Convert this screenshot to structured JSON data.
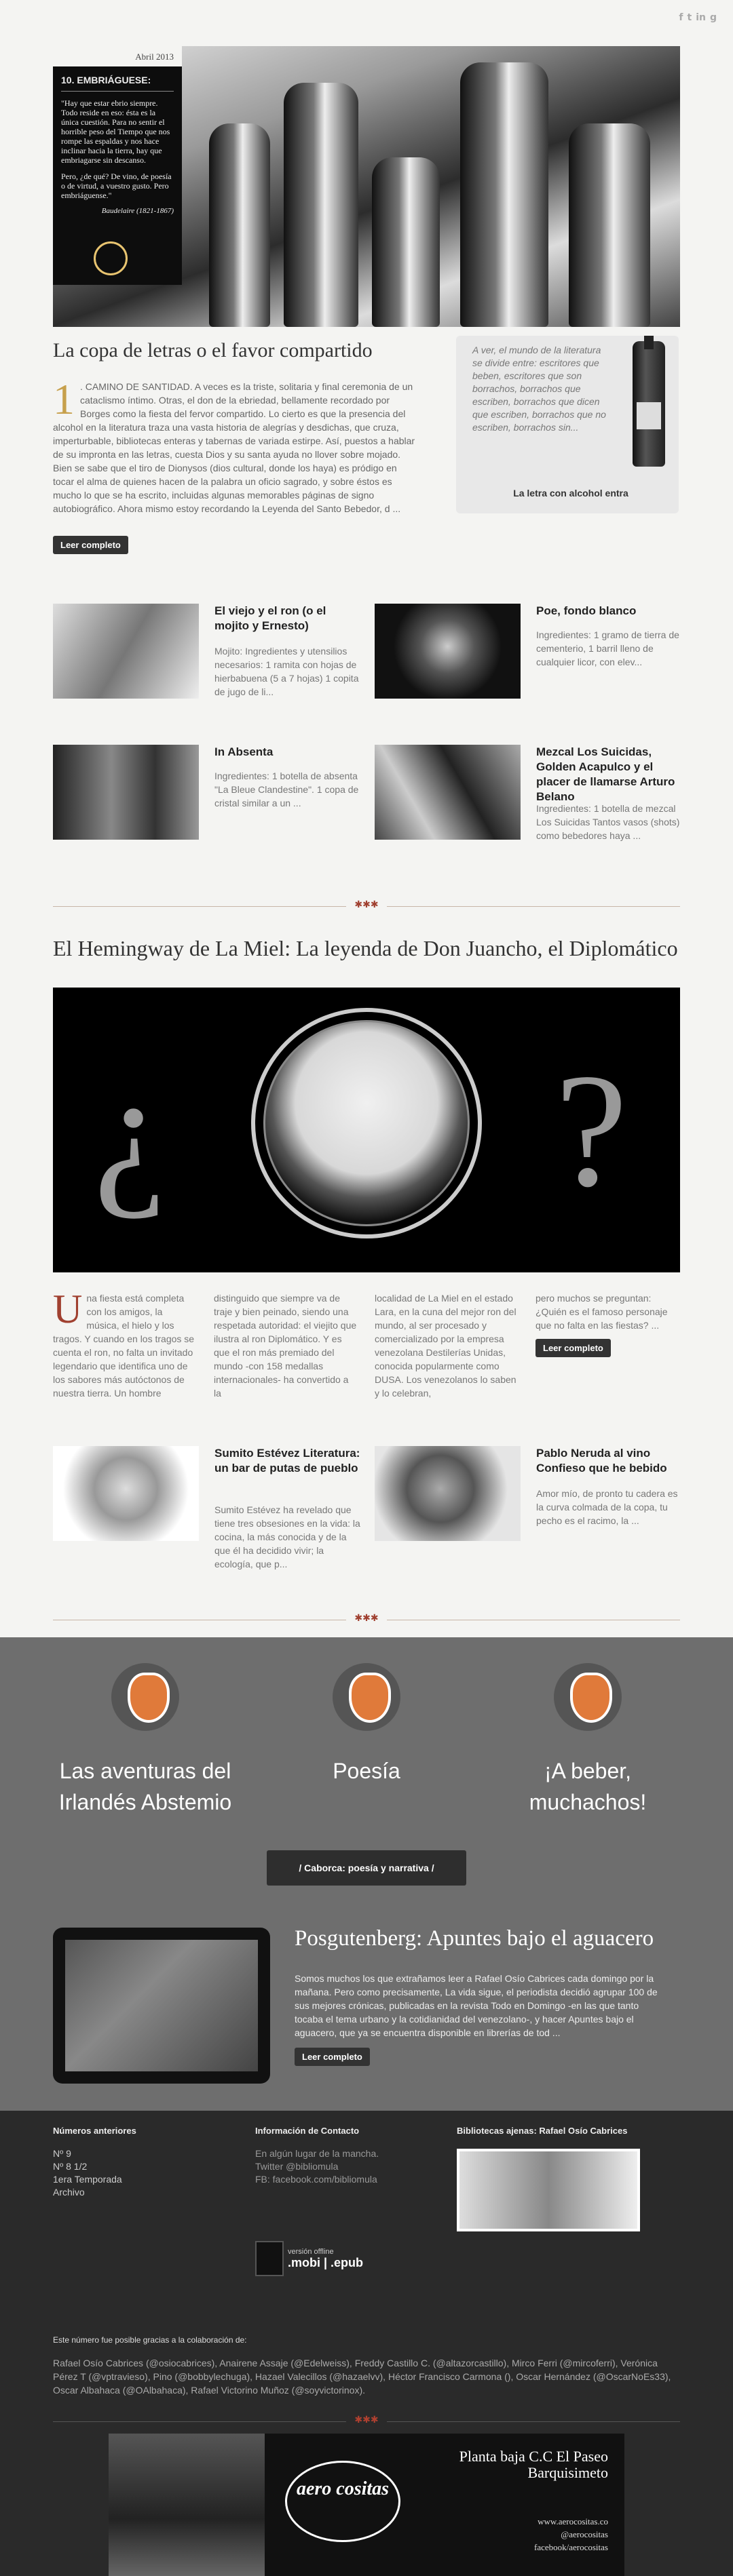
{
  "social": [
    "f",
    "t",
    "in",
    "g"
  ],
  "hero": {
    "date": "Abril 2013",
    "card_title": "10. EMBRIÁGUESE:",
    "card_p1": "\"Hay que estar ebrio siempre. Todo reside en eso: ésta es la única cuestión. Para no sentir el horrible peso del Tiempo que nos rompe las espaldas y nos hace inclinar hacia la tierra, hay que embriagarse sin descanso.",
    "card_p2": "Pero, ¿de qué? De vino, de poesía o de virtud, a vuestro gusto. Pero embriáguense.\"",
    "card_sig": "Baudelaire (1821-1867)"
  },
  "main": {
    "title": "La copa de letras o el favor compartido",
    "drop": "1",
    "lead": ". CAMINO DE SANTIDAD. A veces es la triste, solitaria y final ceremonia de un cataclismo íntimo. Otras, el don de la ebriedad, bellamente recordado por Borges como la fiesta del fervor compartido. Lo cierto es que la presencia del alcohol en la literatura traza una vasta historia de alegrías y desdichas, que cruza, imperturbable, bibliotecas enteras y tabernas de variada estirpe. Así, puestos a hablar de su impronta en las letras, cuesta Dios y su santa ayuda no llover sobre mojado. Bien se sabe que el tiro de Dionysos (dios cultural, donde los haya) es pródigo en tocar el alma de quienes hacen de la palabra un oficio sagrado, y sobre éstos es mucho lo que se ha escrito, incluidas algunas memorables páginas de signo autobiográfico. Ahora mismo estoy recordando la Leyenda del Santo Bebedor, d ...",
    "btn": "Leer completo"
  },
  "quote": {
    "text": "A ver, el mundo de la literatura se divide entre: escritores que beben, escritores que son borrachos, borrachos que escriben, borrachos que dicen que escriben, borrachos que no escriben, borrachos sin...",
    "label": "La letra con alcohol entra"
  },
  "cards1": [
    {
      "title": "El viejo y el ron (o el mojito y Ernesto)",
      "excerpt": "Mojito: Ingredientes y utensilios necesarios: 1 ramita con hojas de hierbabuena (5 a 7 hojas) 1 copita de jugo de li..."
    },
    {
      "title": "Poe, fondo blanco",
      "excerpt": "Ingredientes: 1 gramo de tierra de cementerio, 1 barril lleno de cualquier licor, con elev..."
    },
    {
      "title": "In Absenta",
      "excerpt": "Ingredientes: 1 botella de absenta \"La Bleue Clandestine\". 1 copa de cristal similar a un ..."
    },
    {
      "title": "Mezcal Los Suicidas, Golden Acapulco y el placer de llamarse Arturo Belano",
      "excerpt": "Ingredientes: 1 botella de mezcal Los Suicidas Tantos vasos (shots) como bebedores haya ..."
    }
  ],
  "sep": "✱✱✱",
  "feature": {
    "title": "El Hemingway de La Miel: La leyenda de Don Juancho, el Diplomático",
    "q_left": "¿",
    "q_right": "?",
    "drop": "U",
    "col1": "na fiesta está completa con los amigos, la música, el hielo y los tragos. Y cuando en los tragos se cuenta el ron, no falta un invitado legendario que identifica uno de los sabores más autóctonos de nuestra tierra. Un hombre",
    "col2": "distinguido que siempre va de traje y bien peinado, siendo una respetada autoridad: el viejito que ilustra al ron Diplomático. Y es que el ron más premiado del mundo -con 158 medallas internacionales- ha convertido a la",
    "col3": "localidad de La Miel en el estado Lara, en la cuna del mejor ron del mundo, al ser procesado y comercializado por la empresa venezolana Destilerías Unidas, conocida popularmente como DUSA. Los venezolanos lo saben y lo celebran,",
    "col4": "pero muchos se preguntan: ¿Quién es el famoso personaje que no falta en las fiestas? ...",
    "btn": "Leer completo"
  },
  "cards2": [
    {
      "title": "Sumito Estévez Literatura: un bar de putas de pueblo",
      "excerpt": "Sumito Estévez ha revelado que tiene tres obsesiones en la vida: la cocina, la más conocida y de la que él ha decidido vivir; la ecología, que p..."
    },
    {
      "title": "Pablo Neruda al vino Confieso que he bebido",
      "excerpt": "Amor mío, de pronto tu cadera es la curva colmada de la copa, tu pecho es el racimo, la ..."
    }
  ],
  "grey": {
    "t1": "Las aventuras del Irlandés Abstemio",
    "t2": "Poesía",
    "t3": "¡A beber, muchachos!",
    "btn": "/ Caborca: poesía y narrativa /",
    "pos_title": "Posgutenberg: Apuntes bajo el aguacero",
    "pos_text": "Somos muchos los que extrañamos leer a Rafael Osío Cabrices cada domingo por la mañana. Pero como precisamente, La vida sigue, el periodista decidió agrupar 100 de sus mejores crónicas, publicadas en la revista Todo en Domingo -en las que tanto tocaba el tema urbano y la cotidianidad del venezolano-, y hacer Apuntes bajo el aguacero, que ya se encuentra disponible en librerías de tod ...",
    "pos_btn": "Leer completo"
  },
  "footer": {
    "h1": "Números anteriores",
    "links": [
      "Nº 9",
      "Nº 8 1/2",
      "1era Temporada",
      "Archivo"
    ],
    "h2": "Información de Contacto",
    "c1": "En algún lugar de la mancha.",
    "c2": "Twitter @bibliomula",
    "c3": "FB: facebook.com/bibliomula",
    "h3": "Bibliotecas ajenas: Rafael Osío Cabrices",
    "amz_small": "versión offline",
    "amz": ".mobi | .epub",
    "credits_h": "Este número fue posible gracias a la colaboración de:",
    "credits": "Rafael Osío Cabrices (@osiocabrices), Anairene Assaje (@Edelweiss), Freddy Castillo C. (@altazorcastillo), Mirco Ferri (@mircoferri), Verónica Pérez T (@vptravieso), Pino (@bobbylechuga), Hazael Valecillos (@hazaelvv), Héctor Francisco Carmona (), Oscar Hernández (@OscarNoEs33), Oscar Albahaca (@OAlbahaca), Rafael Victorino Muñoz (@soyvictorinox).",
    "aero": "aero cositas",
    "addr": "Planta baja C.C El Paseo Barquisimeto",
    "web": "www.aerocositas.co\n@aerocositas\nfacebook/aerocositas"
  }
}
